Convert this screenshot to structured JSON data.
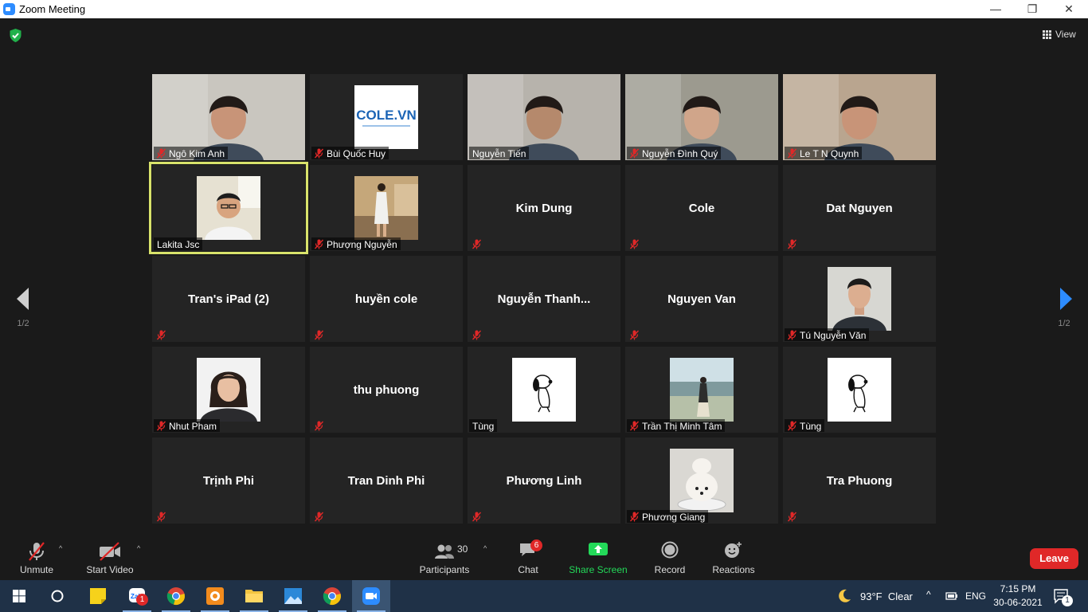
{
  "window": {
    "title": "Zoom Meeting",
    "controls": {
      "minimize": "—",
      "restore": "❐",
      "close": "✕"
    }
  },
  "view_button": {
    "label": "View"
  },
  "page_nav": {
    "left_page": "1/2",
    "right_page": "1/2"
  },
  "participants": [
    {
      "name": "Ngô Kim Anh",
      "kind": "video",
      "muted": true,
      "bg": "#c9c6bf"
    },
    {
      "name": "Bùi Quốc Huy",
      "kind": "avatar",
      "muted": true,
      "avatar": "cole"
    },
    {
      "name": "Nguyễn Tiến",
      "kind": "video",
      "muted": false,
      "bg": "#b7b3ac"
    },
    {
      "name": "Nguyễn Đình Quý",
      "kind": "video",
      "muted": true,
      "bg": "#9c9a8f"
    },
    {
      "name": "Le T N Quynh",
      "kind": "video",
      "muted": true,
      "bg": "#b9a58f"
    },
    {
      "name": "Lakita Jsc",
      "kind": "avatar",
      "muted": false,
      "active": true,
      "avatar": "man-glasses"
    },
    {
      "name": "Phượng Nguyễn",
      "kind": "avatar",
      "muted": true,
      "avatar": "woman-standing"
    },
    {
      "name": "Kim Dung",
      "kind": "name",
      "muted": true
    },
    {
      "name": "Cole",
      "kind": "name",
      "muted": true
    },
    {
      "name": "Dat Nguyen",
      "kind": "name",
      "muted": true
    },
    {
      "name": "Tran's iPad (2)",
      "kind": "name",
      "muted": true
    },
    {
      "name": "huyền cole",
      "kind": "name",
      "muted": true
    },
    {
      "name": "Nguyễn  Thanh...",
      "kind": "name",
      "muted": true
    },
    {
      "name": "Nguyen Van",
      "kind": "name",
      "muted": true
    },
    {
      "name": "Tú Nguyễn Văn",
      "kind": "avatar",
      "muted": true,
      "avatar": "man-portrait"
    },
    {
      "name": "Nhut Pham",
      "kind": "avatar",
      "muted": true,
      "avatar": "woman-portrait"
    },
    {
      "name": "thu phuong",
      "kind": "name",
      "muted": true
    },
    {
      "name": "Tùng",
      "kind": "avatar",
      "muted": false,
      "avatar": "snoopy"
    },
    {
      "name": "Trần Thị Minh Tâm",
      "kind": "avatar",
      "muted": true,
      "avatar": "lake"
    },
    {
      "name": "Tùng",
      "kind": "avatar",
      "muted": true,
      "avatar": "snoopy"
    },
    {
      "name": "Trịnh Phi",
      "kind": "name",
      "muted": true
    },
    {
      "name": "Tran Dinh Phi",
      "kind": "name",
      "muted": true
    },
    {
      "name": "Phương Linh",
      "kind": "name",
      "muted": true
    },
    {
      "name": "Phương Giang",
      "kind": "avatar",
      "muted": true,
      "avatar": "dog"
    },
    {
      "name": "Tra Phuong",
      "kind": "name",
      "muted": true
    }
  ],
  "cole_logo_text": "COLE.VN",
  "toolbar": {
    "unmute": "Unmute",
    "start_video": "Start Video",
    "participants": "Participants",
    "participants_count": "30",
    "chat": "Chat",
    "chat_badge": "6",
    "share_screen": "Share Screen",
    "record": "Record",
    "reactions": "Reactions",
    "leave": "Leave"
  },
  "colors": {
    "active_border": "#d8e36b",
    "share_green": "#23d959",
    "leave_red": "#e02828",
    "muted_red": "#e02828"
  },
  "taskbar": {
    "apps": [
      "start",
      "search",
      "sticky-notes",
      "zalo",
      "chrome",
      "folder-app",
      "file-explorer",
      "photos",
      "chrome",
      "zoom"
    ],
    "zalo_badge": "1",
    "weather": "93°F  Clear",
    "language": "ENG",
    "time": "7:15 PM",
    "date": "30-06-2021",
    "notif_count": "1"
  }
}
